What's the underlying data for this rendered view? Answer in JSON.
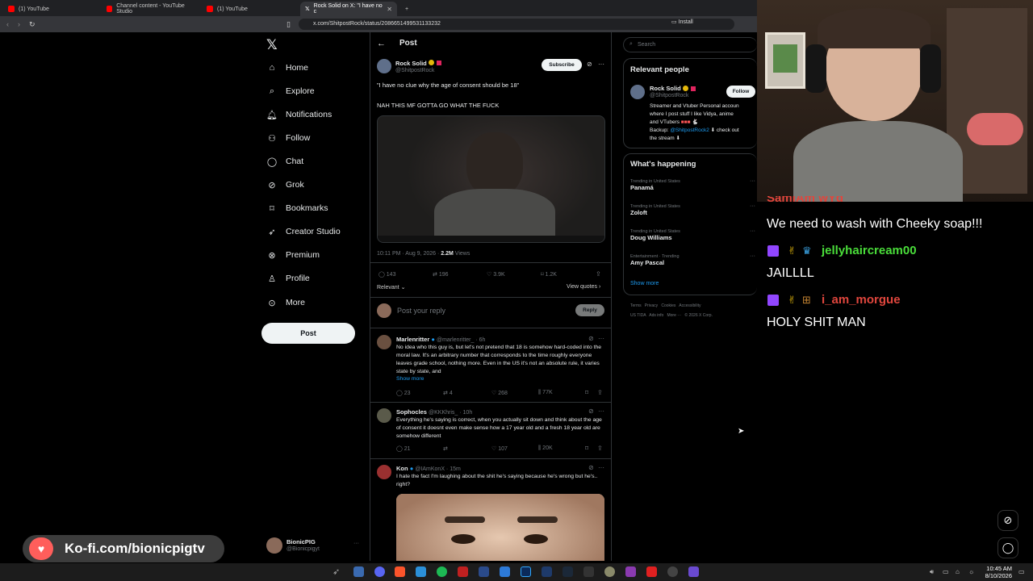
{
  "browser": {
    "tabs": [
      {
        "label": "(1) YouTube"
      },
      {
        "label": "Channel content - YouTube Studio"
      },
      {
        "label": "(1) YouTube"
      },
      {
        "label": "Rock Solid on X: \"I have no c"
      }
    ],
    "new_tab": "+",
    "url": "x.com/ShitpostRock/status/2086651499531133232",
    "install_label": "Install"
  },
  "nav": {
    "items": [
      {
        "label": "Home",
        "icon": "home-icon"
      },
      {
        "label": "Explore",
        "icon": "search-icon"
      },
      {
        "label": "Notifications",
        "icon": "bell-icon"
      },
      {
        "label": "Follow",
        "icon": "person-plus-icon"
      },
      {
        "label": "Chat",
        "icon": "chat-bubble-icon"
      },
      {
        "label": "Grok",
        "icon": "grok-icon"
      },
      {
        "label": "Bookmarks",
        "icon": "bookmark-icon"
      },
      {
        "label": "Creator Studio",
        "icon": "rocket-icon"
      },
      {
        "label": "Premium",
        "icon": "x-circle-icon"
      },
      {
        "label": "Profile",
        "icon": "person-icon"
      },
      {
        "label": "More",
        "icon": "more-circle-icon"
      }
    ],
    "post_button": "Post",
    "account": {
      "name": "BionicPIG",
      "handle": "@Bionicpigyt"
    }
  },
  "post": {
    "header_title": "Post",
    "author_name": "Rock Solid",
    "author_handle": "@ShitpostRock",
    "subscribe_label": "Subscribe",
    "text1": "\"I have no clue why the age of consent should be 18\"",
    "text2": "NAH THIS MF GOTTA GO WHAT THE FUCK",
    "timestamp": "10:11 PM · Aug 9, 2026 ·",
    "views_count": "2.2M",
    "views_label": "Views",
    "stats": {
      "replies": "143",
      "reposts": "196",
      "likes": "3.9K",
      "bookmarks": "1.2K"
    },
    "sort_label": "Relevant",
    "view_quotes": "View quotes",
    "reply_placeholder": "Post your reply",
    "reply_button": "Reply"
  },
  "replies": [
    {
      "name": "Marlenritter",
      "handle": "@marlenritter_ · 6h",
      "text": "No idea who this guy is, but let's not pretend that 18 is somehow hard-coded into the moral law. It's an arbitrary number that corresponds to the time roughly everyone leaves grade school, nothing more. Even in the US it's not an absolute rule, it varies state by state, and",
      "show_more": "Show more",
      "replies": "23",
      "reposts": "4",
      "likes": "268",
      "views": "77K"
    },
    {
      "name": "Sophocles",
      "handle": "@KKKhris_ · 10h",
      "text": "Everything he's saying is correct, when you actually sit down and think about the age of consent it doesnt even make sense how a 17 year old and a fresh 18 year old are somehow different",
      "replies": "21",
      "reposts": "",
      "likes": "107",
      "views": "20K"
    },
    {
      "name": "Kon",
      "handle": "@IAmKonX · 15m",
      "text": "I hate the fact I'm laughing about the shit he's saying because he's wrong but he's.. right?"
    }
  ],
  "sidebar": {
    "search_placeholder": "Search",
    "relevant_title": "Relevant people",
    "person": {
      "name": "Rock Solid",
      "handle": "@ShitpostRock",
      "follow_label": "Follow",
      "bio1": "Streamer and Vtuber Personal accoun",
      "bio2": "where I post stuff I like Vidya, anime",
      "bio3": "and VTubers",
      "bio4_prefix": "Backup:",
      "bio4_link": "@ShitpostRock2",
      "bio4_suffix": "check out",
      "bio5": "the stream"
    },
    "happening_title": "What's happening",
    "trends": [
      {
        "context": "Trending in United States",
        "name": "Panamá"
      },
      {
        "context": "Trending in United States",
        "name": "Zoloft"
      },
      {
        "context": "Trending in United States",
        "name": "Doug Williams"
      },
      {
        "context": "Entertainment · Trending",
        "name": "Amy Pascal"
      }
    ],
    "show_more": "Show more",
    "footer1": "Terms   Privacy   Cookies   Accessibility",
    "footer2": "US TIDA   Ads info   More ···   © 2026 X Corp."
  },
  "chat": {
    "partial_line": "SamiAm wYd",
    "msg1": "We need to wash with Cheeky soap!!!",
    "user2": "jellyhaircream00",
    "msg2": "JAILLLL",
    "user3": "i_am_morgue",
    "msg3": "HOLY SHIT MAN",
    "user2_color": "#4ade3a",
    "user3_color": "#e0463d"
  },
  "kofi": {
    "label": "Ko-fi.com/bionicpigtv"
  },
  "taskbar": {
    "time": "10:45 AM",
    "date": "8/10/2026"
  },
  "colors": {
    "accent": "#1d9bf0",
    "background": "#000000",
    "border": "#2f3336"
  }
}
